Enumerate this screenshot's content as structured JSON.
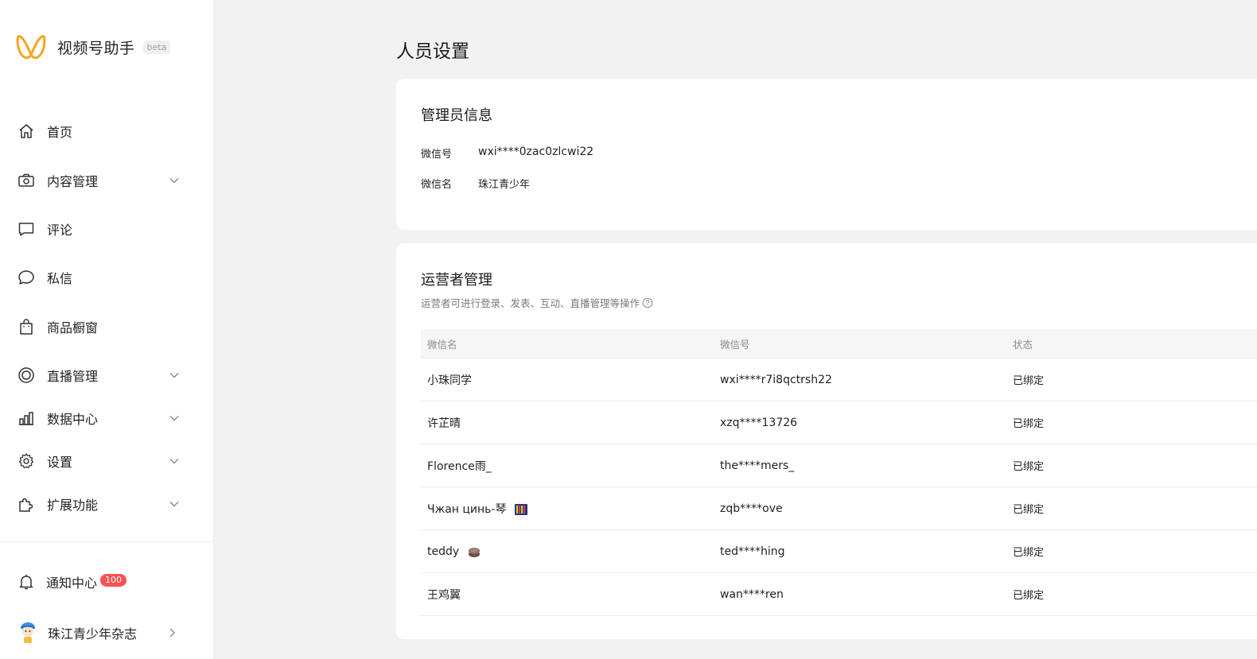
{
  "app": {
    "name": "视频号助手",
    "badge": "beta",
    "brand_color": "#f5a623"
  },
  "sidebar": {
    "items": [
      {
        "label": "首页",
        "icon": "home-icon",
        "expandable": false
      },
      {
        "label": "内容管理",
        "icon": "camera-icon",
        "expandable": true
      },
      {
        "label": "评论",
        "icon": "comment-icon",
        "expandable": false
      },
      {
        "label": "私信",
        "icon": "message-bubble-icon",
        "expandable": false
      },
      {
        "label": "商品橱窗",
        "icon": "shopping-bag-icon",
        "expandable": false
      },
      {
        "label": "直播管理",
        "icon": "live-circle-icon",
        "expandable": true
      },
      {
        "label": "数据中心",
        "icon": "bar-chart-icon",
        "expandable": true
      },
      {
        "label": "设置",
        "icon": "gear-icon",
        "expandable": true
      },
      {
        "label": "扩展功能",
        "icon": "puzzle-icon",
        "expandable": true
      }
    ],
    "notify": {
      "label": "通知中心",
      "count": "100",
      "icon": "bell-icon"
    },
    "account": {
      "name": "珠江青少年杂志",
      "icon": "avatar"
    }
  },
  "main": {
    "title": "人员设置",
    "admin": {
      "title": "管理员信息",
      "wechat_id_label": "微信号",
      "wechat_id": "wxi****0zac0zlcwi22",
      "wechat_name_label": "微信名",
      "wechat_name": "珠江青少年"
    },
    "operators": {
      "title": "运营者管理",
      "subtitle": "运营者可进行登录、发表、互动、直播管理等操作",
      "columns": [
        "微信名",
        "微信号",
        "状态"
      ],
      "rows": [
        {
          "name": "小珠同学",
          "emoji": "",
          "id": "wxi****r7i8qctrsh22",
          "status": "已绑定"
        },
        {
          "name": "许芷晴",
          "emoji": "",
          "id": "xzq****13726",
          "status": "已绑定"
        },
        {
          "name": "Florence雨_",
          "emoji": "",
          "id": "the****mers_",
          "status": "已绑定"
        },
        {
          "name": "Чжан цинь-琴",
          "emoji": "flag-emoji",
          "id": "zqb****ove",
          "status": "已绑定"
        },
        {
          "name": "teddy",
          "emoji": "cake-emoji",
          "id": "ted****hing",
          "status": "已绑定"
        },
        {
          "name": "王鸡翼",
          "emoji": "",
          "id": "wan****ren",
          "status": "已绑定"
        }
      ]
    }
  }
}
